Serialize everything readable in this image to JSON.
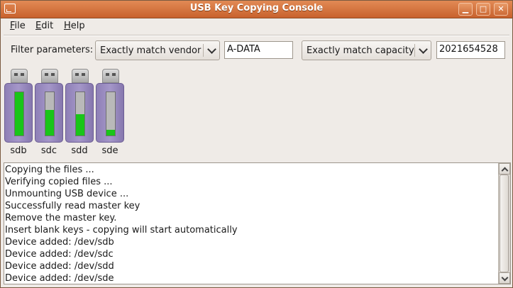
{
  "window": {
    "title": "USB Key Copying Console"
  },
  "menu": {
    "items": [
      {
        "label": "File",
        "mnemonic": "F",
        "rest": "ile"
      },
      {
        "label": "Edit",
        "mnemonic": "E",
        "rest": "dit"
      },
      {
        "label": "Help",
        "mnemonic": "H",
        "rest": "elp"
      }
    ]
  },
  "filter": {
    "label": "Filter parameters:",
    "vendor_mode": "Exactly match vendor",
    "vendor_value": "A-DATA",
    "capacity_mode": "Exactly match capacity",
    "capacity_value": "2021654528"
  },
  "drives": [
    {
      "name": "sdb",
      "progress_percent": 100
    },
    {
      "name": "sdc",
      "progress_percent": 59
    },
    {
      "name": "sdd",
      "progress_percent": 49
    },
    {
      "name": "sde",
      "progress_percent": 13
    }
  ],
  "log": {
    "lines": [
      "Copying the files ...",
      "Verifying copied files ...",
      "Unmounting USB device ...",
      "Successfully read master key",
      "Remove the master key.",
      "Insert blank keys - copying will start automatically",
      "Device added: /dev/sdb",
      "Device added: /dev/sdc",
      "Device added: /dev/sdd",
      "Device added: /dev/sde"
    ]
  },
  "colors": {
    "titlebar": "#d0703a",
    "progress_fill": "#19c519",
    "drive_body": "#9a8cc0"
  },
  "icons": {
    "app": "terminal-window-icon",
    "minimize": "minimize-icon",
    "maximize": "maximize-icon",
    "close": "close-icon"
  }
}
